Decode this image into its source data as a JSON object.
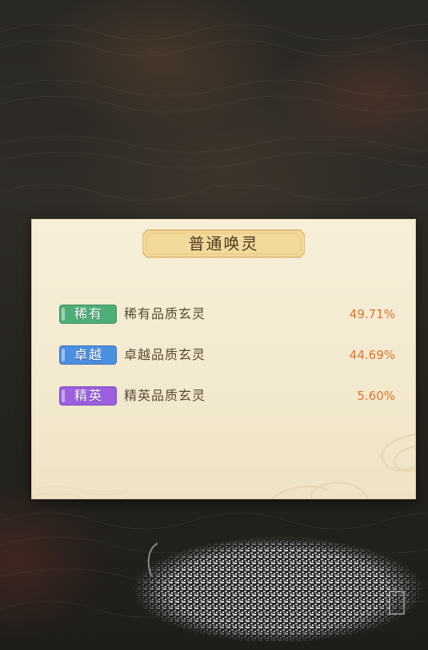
{
  "dialog": {
    "title": "普通唤灵"
  },
  "rates": [
    {
      "badge": "稀有",
      "badge_color": "#4fae78",
      "label": "稀有品质玄灵",
      "rate": "49.71%"
    },
    {
      "badge": "卓越",
      "badge_color": "#4b8fe0",
      "label": "卓越品质玄灵",
      "rate": "44.69%"
    },
    {
      "badge": "精英",
      "badge_color": "#9b5fe0",
      "label": "精英品质玄灵",
      "rate": "5.60%"
    }
  ],
  "colors": {
    "rate_text": "#e2722a",
    "dialog_bg": "#f5ecd4",
    "title_banner": "#f3d99a"
  },
  "icons": {
    "obscured_close": "obscured-close-icon"
  }
}
